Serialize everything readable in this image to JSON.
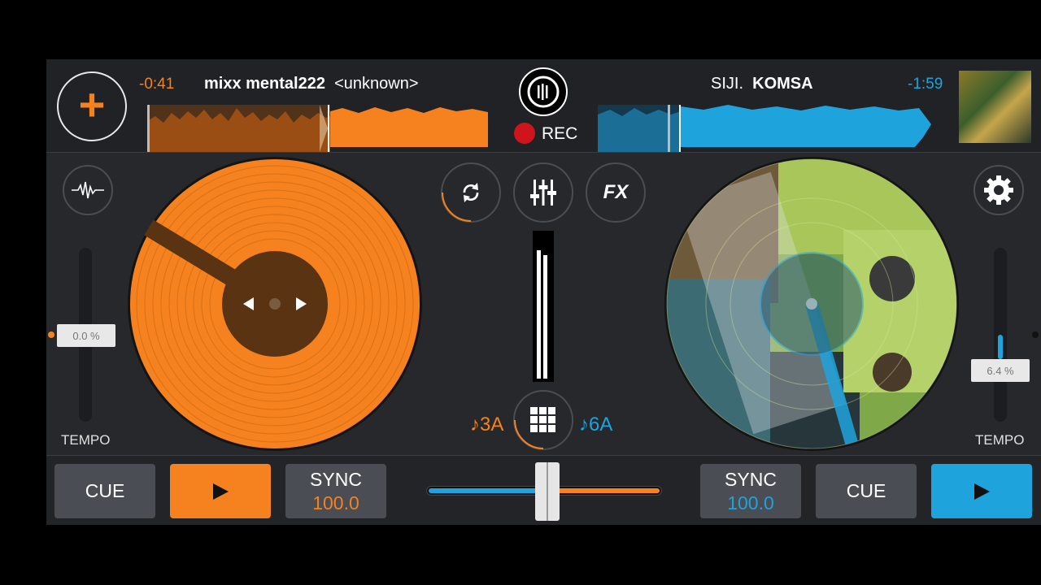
{
  "left_deck": {
    "time": "-0:41",
    "track_title": "mixx mental222",
    "track_artist": "<unknown>",
    "tempo_value": "0.0 %",
    "tempo_label": "TEMPO",
    "key": "♪3A",
    "cue_label": "CUE",
    "play_icon": "play-icon",
    "sync_label": "SYNC",
    "bpm": "100.0",
    "color": "#f5821f"
  },
  "right_deck": {
    "time": "-1:59",
    "track_artist": "SIJI.",
    "track_title": "KOMSA",
    "tempo_value": "6.4 %",
    "tempo_label": "TEMPO",
    "key": "♪6A",
    "cue_label": "CUE",
    "play_icon": "play-icon",
    "sync_label": "SYNC",
    "bpm": "100.0",
    "color": "#1fa3dc"
  },
  "center": {
    "rec_label": "REC",
    "fx_label": "FX",
    "crossfader_position": 0.5
  },
  "icons": [
    "plus-icon",
    "waveform-icon",
    "loop-icon",
    "mixer-sliders-icon",
    "gear-icon",
    "grid-icon",
    "record-logo-icon"
  ]
}
